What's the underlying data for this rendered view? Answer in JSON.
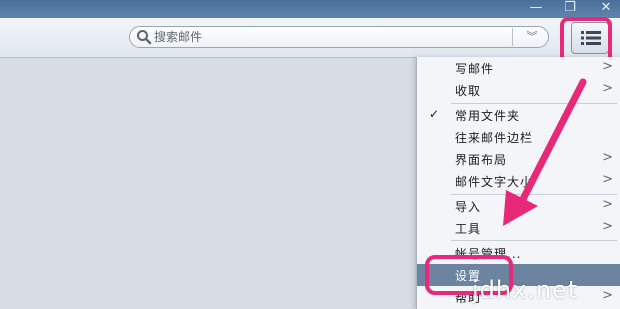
{
  "window_controls": {
    "minimize_icon": "minimize-icon",
    "restore_icon": "restore-icon",
    "close_icon": "close-icon",
    "minimize_glyph": "—",
    "restore_glyph": "❐",
    "close_glyph": "✕"
  },
  "search": {
    "placeholder": "搜索邮件",
    "icon": "search-icon",
    "filter_glyph": "︾"
  },
  "toolbar": {
    "menu_icon": "list-menu-icon"
  },
  "menu": {
    "items": [
      {
        "label": "写邮件",
        "submenu": true,
        "checked": false
      },
      {
        "label": "收取",
        "submenu": true,
        "checked": false
      },
      {
        "label": "常用文件夹",
        "submenu": false,
        "checked": true
      },
      {
        "label": "往来邮件边栏",
        "submenu": false,
        "checked": false
      },
      {
        "label": "界面布局",
        "submenu": true,
        "checked": false
      },
      {
        "label": "邮件文字大小",
        "submenu": true,
        "checked": false
      },
      {
        "label": "导入",
        "submenu": true,
        "checked": false
      },
      {
        "label": "工具",
        "submenu": true,
        "checked": false
      },
      {
        "label": "帐号管理...",
        "submenu": false,
        "checked": false
      },
      {
        "label": "设置",
        "submenu": false,
        "checked": false,
        "selected": true
      },
      {
        "label": "帮助",
        "submenu": true,
        "checked": false
      }
    ],
    "check_glyph": "✓",
    "arrow_glyph": ">"
  },
  "annotations": {
    "highlight_color": "#e8297a"
  },
  "watermark": "jdhx.net"
}
